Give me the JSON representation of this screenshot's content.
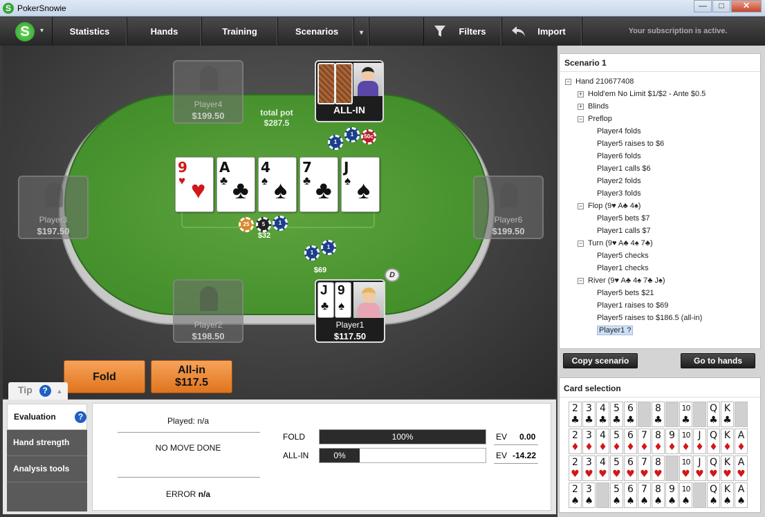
{
  "window": {
    "title": "PokerSnowie",
    "logo": "S",
    "minimize": "—",
    "maximize": "□",
    "close": "✕"
  },
  "menu": {
    "logo": "S",
    "caret": "▾",
    "items": [
      "Statistics",
      "Hands",
      "Training",
      "Scenarios"
    ],
    "filters": "Filters",
    "import": "Import",
    "subscription": "Your subscription is active."
  },
  "table": {
    "total_pot_label": "total pot",
    "total_pot": "$287.5",
    "players": [
      {
        "name": "Player4",
        "stack": "$199.50"
      },
      {
        "name": "Player3",
        "stack": "$197.50"
      },
      {
        "name": "Player6",
        "stack": "$199.50"
      },
      {
        "name": "Player2",
        "stack": "$198.50"
      }
    ],
    "allin_label": "ALL-IN",
    "hero": {
      "name": "Player1",
      "stack": "$117.50",
      "cards": [
        {
          "rank": "J",
          "suit": "♣"
        },
        {
          "rank": "9",
          "suit": "♠"
        }
      ]
    },
    "board": [
      {
        "rank": "9",
        "suit": "♥",
        "color": "red"
      },
      {
        "rank": "A",
        "suit": "♣",
        "color": "black"
      },
      {
        "rank": "4",
        "suit": "♠",
        "color": "black"
      },
      {
        "rank": "7",
        "suit": "♣",
        "color": "black"
      },
      {
        "rank": "J",
        "suit": "♠",
        "color": "black"
      }
    ],
    "bets": {
      "center": "$32",
      "hero": "$69"
    },
    "chips": {
      "top": [
        "1",
        "1",
        "50c"
      ],
      "center": [
        "25",
        "5",
        "1"
      ],
      "hero": [
        "1",
        "1"
      ]
    },
    "dealer": "D"
  },
  "actions": {
    "fold": "Fold",
    "allin_line1": "All-in",
    "allin_line2": "$117.5"
  },
  "tip": {
    "label": "Tip",
    "help": "?",
    "collapse": "▲"
  },
  "tabs": {
    "evaluation": "Evaluation",
    "hand_strength": "Hand strength",
    "analysis_tools": "Analysis tools",
    "help": "?"
  },
  "evaluation": {
    "played": "Played: n/a",
    "no_move": "NO MOVE DONE",
    "error_label": "ERROR",
    "error_value": "n/a",
    "rows": [
      {
        "action": "FOLD",
        "pct": "100%",
        "fraction": 1.0,
        "ev_label": "EV",
        "ev": "0.00"
      },
      {
        "action": "ALL-IN",
        "pct": "0%",
        "fraction": 0.0,
        "ev_label": "EV",
        "ev": "-14.22"
      }
    ]
  },
  "scenario": {
    "title": "Scenario 1",
    "tree": [
      {
        "level": 0,
        "pm": "−",
        "text": "Hand 210677408"
      },
      {
        "level": 1,
        "pm": "+",
        "text": "Hold'em No Limit $1/$2 - Ante $0.5"
      },
      {
        "level": 1,
        "pm": "+",
        "text": "Blinds"
      },
      {
        "level": 1,
        "pm": "−",
        "text": "Preflop"
      },
      {
        "level": 2,
        "pm": "",
        "text": "Player4 folds"
      },
      {
        "level": 2,
        "pm": "",
        "text": "Player5 raises to $6"
      },
      {
        "level": 2,
        "pm": "",
        "text": "Player6 folds"
      },
      {
        "level": 2,
        "pm": "",
        "text": "Player1 calls $6"
      },
      {
        "level": 2,
        "pm": "",
        "text": "Player2 folds"
      },
      {
        "level": 2,
        "pm": "",
        "text": "Player3 folds"
      },
      {
        "level": 1,
        "pm": "−",
        "text": "Flop (9♥ A♣ 4♠)"
      },
      {
        "level": 2,
        "pm": "",
        "text": "Player5 bets $7"
      },
      {
        "level": 2,
        "pm": "",
        "text": "Player1 calls $7"
      },
      {
        "level": 1,
        "pm": "−",
        "text": "Turn (9♥ A♣ 4♠ 7♣)"
      },
      {
        "level": 2,
        "pm": "",
        "text": "Player5 checks"
      },
      {
        "level": 2,
        "pm": "",
        "text": "Player1 checks"
      },
      {
        "level": 1,
        "pm": "−",
        "text": "River (9♥ A♣ 4♠ 7♣ J♠)"
      },
      {
        "level": 2,
        "pm": "",
        "text": "Player5 bets $21"
      },
      {
        "level": 2,
        "pm": "",
        "text": "Player1 raises to $69"
      },
      {
        "level": 2,
        "pm": "",
        "text": "Player5 raises to $186.5 (all-in)"
      },
      {
        "level": 2,
        "pm": "",
        "text": "Player1 ?",
        "selected": true
      }
    ],
    "copy": "Copy scenario",
    "goto": "Go to hands"
  },
  "card_selection": {
    "title": "Card selection",
    "ranks": [
      "2",
      "3",
      "4",
      "5",
      "6",
      "7",
      "8",
      "9",
      "10",
      "J",
      "Q",
      "K",
      "A"
    ],
    "rows": [
      {
        "suit": "♣",
        "color": "black",
        "empty": [
          5,
          7,
          9,
          12
        ]
      },
      {
        "suit": "♦",
        "color": "red",
        "empty": []
      },
      {
        "suit": "♥",
        "color": "red",
        "empty": [
          7
        ]
      },
      {
        "suit": "♠",
        "color": "black",
        "empty": [
          2,
          9
        ]
      }
    ]
  }
}
